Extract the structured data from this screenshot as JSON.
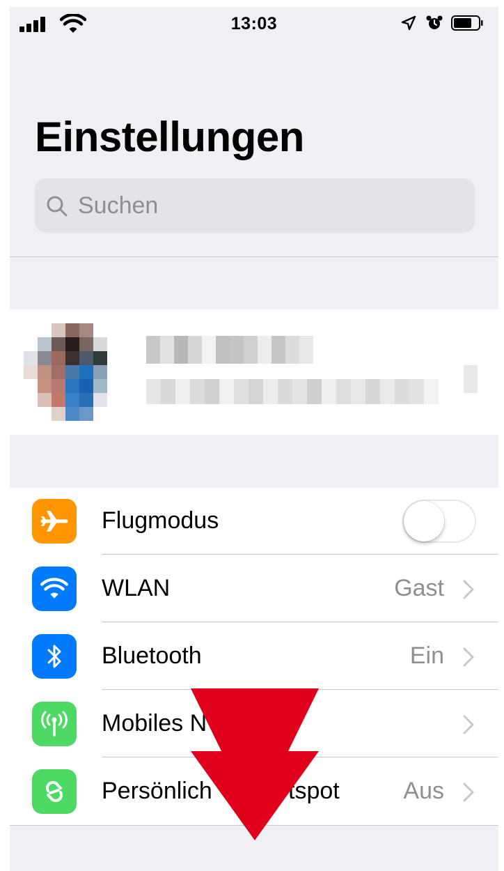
{
  "status_bar": {
    "time": "13:03",
    "icons": [
      "signal-icon",
      "wifi-icon",
      "location-arrow-icon",
      "alarm-clock-icon",
      "battery-icon"
    ]
  },
  "header": {
    "title": "Einstellungen"
  },
  "search": {
    "placeholder": "Suchen",
    "icon": "search-icon"
  },
  "profile": {
    "pixelated": true
  },
  "settings": [
    {
      "id": "flugmodus",
      "label": "Flugmodus",
      "icon": "airplane-icon",
      "icon_color": "#ff9500",
      "control": "toggle",
      "toggle_on": false
    },
    {
      "id": "wlan",
      "label": "WLAN",
      "value": "Gast",
      "icon": "wifi-icon",
      "icon_color": "#007aff",
      "control": "chevron"
    },
    {
      "id": "bluetooth",
      "label": "Bluetooth",
      "value": "Ein",
      "icon": "bluetooth-icon",
      "icon_color": "#007aff",
      "control": "chevron"
    },
    {
      "id": "mobiles-netz",
      "label": "Mobiles N",
      "value": "",
      "icon": "antenna-icon",
      "icon_color": "#4cd964",
      "control": "chevron"
    },
    {
      "id": "hotspot",
      "label_left": "Persönlich",
      "label_right": "tspot",
      "value": "Aus",
      "icon": "hotspot-icon",
      "icon_color": "#4cd964",
      "control": "chevron"
    }
  ],
  "overlay": {
    "arrow_color": "#e0001b",
    "arrow_direction": "down"
  }
}
